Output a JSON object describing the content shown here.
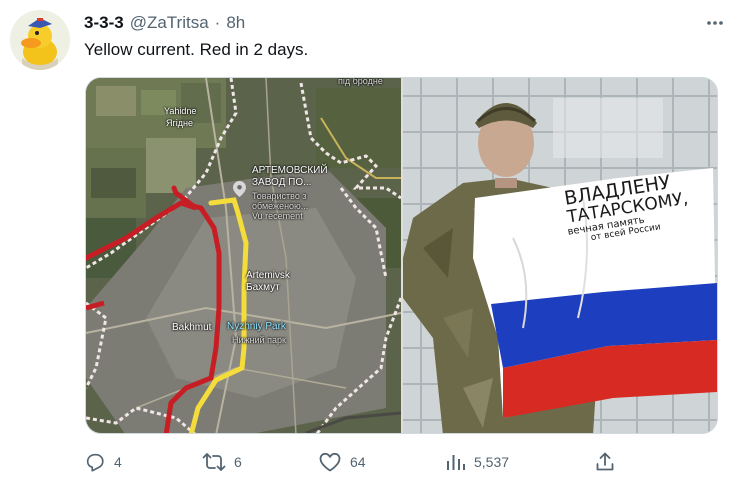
{
  "tweet": {
    "author_name": "3-3-3",
    "handle": "@ZaTritsa",
    "separator": "·",
    "time": "8h",
    "text": "Yellow current. Red in 2 days."
  },
  "map": {
    "labels": {
      "top_edge": "під бродне",
      "yahidne_en": "Yahidne",
      "yahidne_uk": "Ягідне",
      "factory_line1": "АРТЕМОВСКИЙ",
      "factory_line2": "ЗАВОД ПО...",
      "factory_line3": "Товариство з",
      "factory_line4": "обмеженою...",
      "factory_line5": "Vu recement",
      "artemivsk": "Artemivsk",
      "bakhmut_uk": "Бахмут",
      "bakhmut_en": "Bakhmut",
      "nyzhniy_park": "Nyzhniy Park",
      "nyzhniy_park_ru": "Нижний парк"
    },
    "line_colors": {
      "yellow_current": "#f4dc3a",
      "red_two_days": "#c61e24",
      "frontline_border": "#f0e6e6"
    }
  },
  "photo": {
    "flag_text_line1": "ВЛАДЛЕНУ",
    "flag_text_line2": "ТАТАРСКОМУ,",
    "flag_text_line3": "вечная память",
    "flag_text_line4": "от всей России"
  },
  "actions": {
    "reply": {
      "icon": "reply-icon",
      "count": "4"
    },
    "retweet": {
      "icon": "retweet-icon",
      "count": "6"
    },
    "like": {
      "icon": "heart-icon",
      "count": "64"
    },
    "views": {
      "icon": "views-icon",
      "count": "5,537"
    },
    "share": {
      "icon": "share-icon"
    }
  }
}
